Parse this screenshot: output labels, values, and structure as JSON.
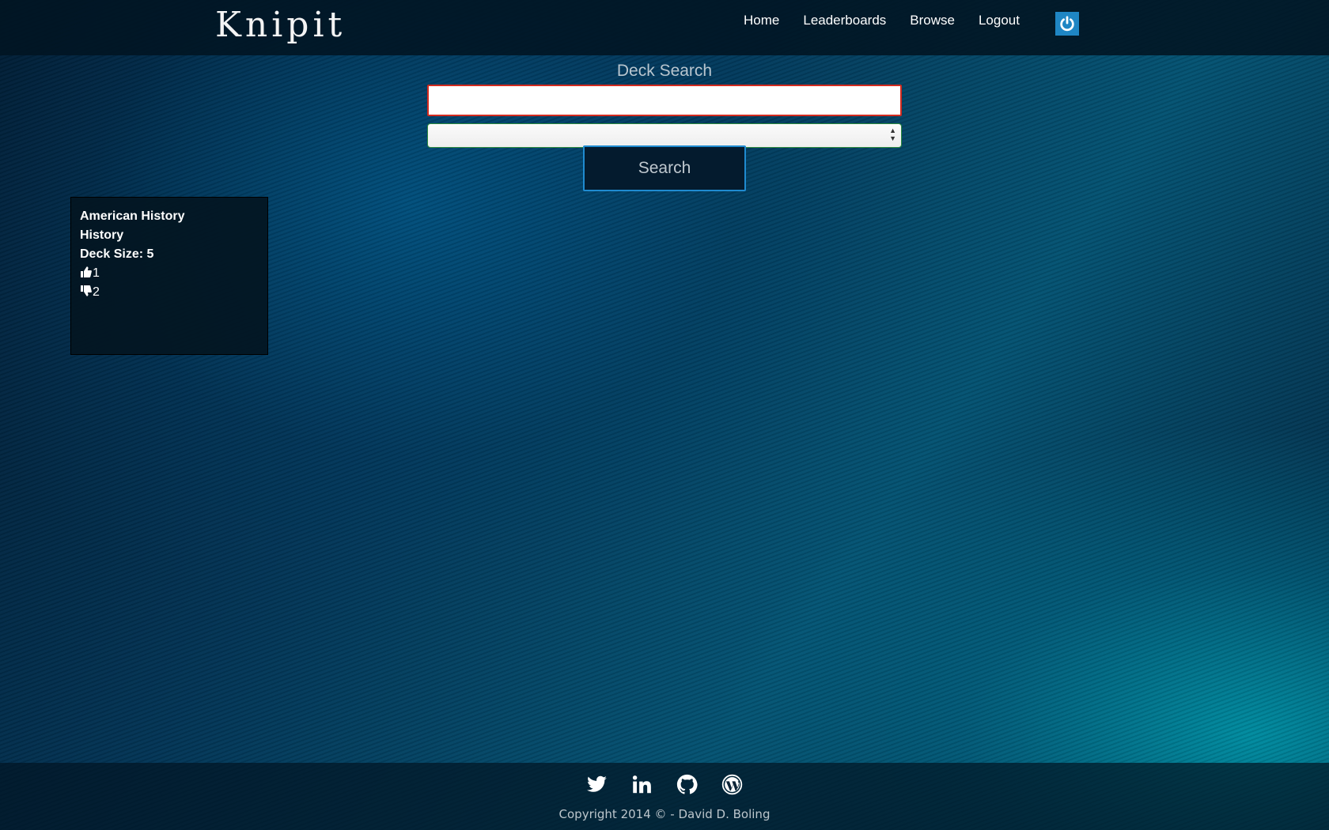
{
  "header": {
    "brand": "Knipit",
    "nav": [
      {
        "label": "Home"
      },
      {
        "label": "Leaderboards"
      },
      {
        "label": "Browse"
      },
      {
        "label": "Logout"
      }
    ],
    "power_icon": "power-icon"
  },
  "search": {
    "title": "Deck Search",
    "input_value": "",
    "input_placeholder": "",
    "category_selected": "",
    "button_label": "Search"
  },
  "decks": [
    {
      "title": "American History",
      "category": "History",
      "size_text": "Deck Size: 5",
      "likes": "1",
      "dislikes": "2"
    }
  ],
  "footer": {
    "icons": [
      "twitter-icon",
      "linkedin-icon",
      "github-icon",
      "wordpress-icon"
    ],
    "copyright": "Copyright 2014 © - David D. Boling"
  },
  "colors": {
    "accent_blue": "#1f86c4",
    "input_error_border": "#d32b1f",
    "select_border": "#2d8a3e"
  }
}
